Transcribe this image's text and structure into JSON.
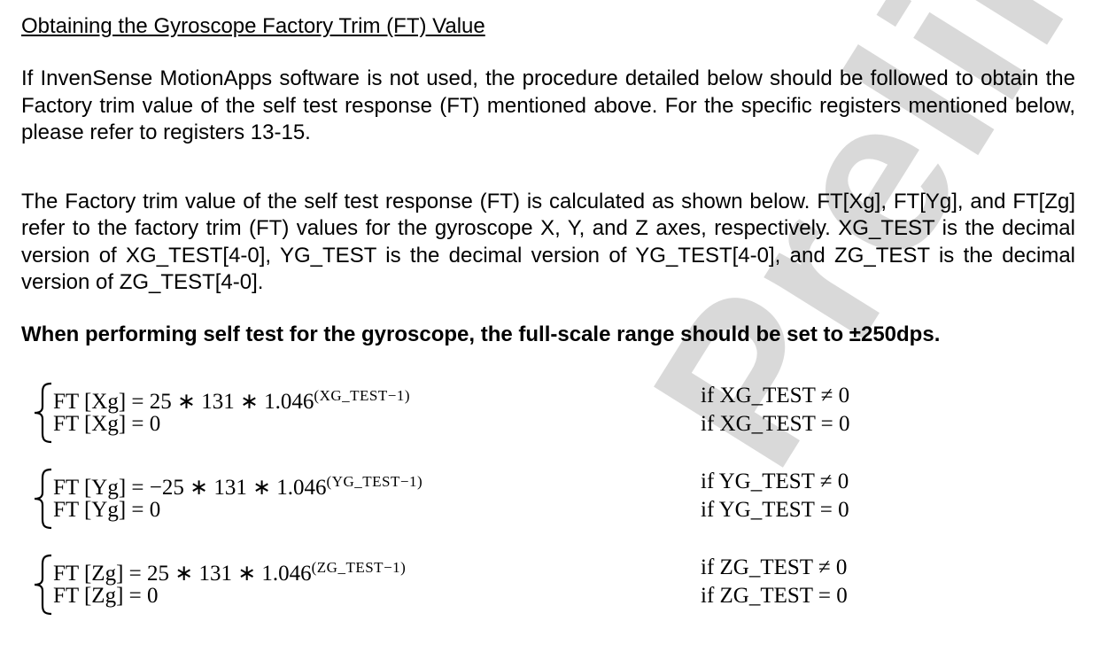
{
  "heading": "Obtaining the Gyroscope Factory Trim (FT) Value",
  "paragraph1": "If InvenSense MotionApps software is not used, the procedure detailed below should be followed to obtain the Factory trim value of the self test response (FT) mentioned above. For the specific registers mentioned below, please refer to registers 13-15.",
  "paragraph2": "The Factory trim value of the self test response (FT) is calculated as shown below.  FT[Xg], FT[Yg], and FT[Zg] refer to the factory trim (FT) values for the gyroscope X, Y, and Z axes, respectively. XG_TEST is the decimal version of XG_TEST[4-0], YG_TEST is the decimal version of YG_TEST[4-0], and ZG_TEST is the decimal version of ZG_TEST[4-0].",
  "bold_note": "When performing self test for the gyroscope, the full-scale range should be set to ±250dps.",
  "watermark": "Preliminary",
  "equations": [
    {
      "line1_base": "FT [Xg]  =  25 ∗ 131 ∗ 1.046",
      "line1_exp": "(XG_TEST−1)",
      "line2": "FT [Xg] = 0",
      "cond1": "if XG_TEST ≠ 0",
      "cond2": "if XG_TEST = 0"
    },
    {
      "line1_base": "FT [Yg] =  −25 ∗ 131 ∗ 1.046",
      "line1_exp": "(YG_TEST−1)",
      "line2": "FT [Yg] =  0",
      "cond1": "if YG_TEST ≠ 0",
      "cond2": "if YG_TEST = 0"
    },
    {
      "line1_base": "FT [Zg]  =  25 ∗ 131 ∗ 1.046",
      "line1_exp": "(ZG_TEST−1)",
      "line2": "FT [Zg] = 0",
      "cond1": "if ZG_TEST ≠ 0",
      "cond2": "if ZG_TEST = 0"
    }
  ],
  "colors": {
    "text": "#000000",
    "watermark": "#d9d9d9",
    "background": "#ffffff"
  }
}
